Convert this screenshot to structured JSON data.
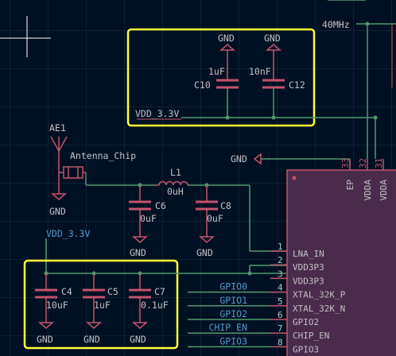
{
  "top_right": {
    "freq": "40MHz"
  },
  "box1": {
    "gnd_a": "GND",
    "gnd_b": "GND",
    "c10_value": "1uF",
    "c10_ref": "C10",
    "c12_value": "10nF",
    "c12_ref": "C12",
    "net": "VDD_3.3V"
  },
  "antenna": {
    "ref": "AE1",
    "name": "Antenna_Chip",
    "gnd": "GND"
  },
  "gnd_right": "GND",
  "l1": {
    "ref": "L1",
    "value": "0uH"
  },
  "c6": {
    "ref": "C6",
    "value": "0uF",
    "gnd": "GND"
  },
  "c8": {
    "ref": "C8",
    "value": "0uF",
    "gnd": "GND"
  },
  "vdd_left": "VDD_3.3V",
  "box2": {
    "c4_ref": "C4",
    "c4_value": "10uF",
    "gnd4": "GND",
    "c5_ref": "C5",
    "c5_value": "1uF",
    "gnd5": "GND",
    "c7_ref": "C7",
    "c7_value": "0.1uF",
    "gnd7": "GND"
  },
  "chip": {
    "top_pins": [
      {
        "num": "33",
        "name": "EP"
      },
      {
        "num": "32",
        "name": "VDDA"
      },
      {
        "num": "31",
        "name": "VDDA"
      }
    ],
    "pins": [
      {
        "num": "1",
        "name": "LNA_IN",
        "net": ""
      },
      {
        "num": "2",
        "name": "VDD3P3",
        "net": ""
      },
      {
        "num": "3",
        "name": "VDD3P3",
        "net": ""
      },
      {
        "num": "4",
        "name": "XTAL_32K_P",
        "net": "GPIO0"
      },
      {
        "num": "5",
        "name": "XTAL_32K_N",
        "net": "GPIO1"
      },
      {
        "num": "6",
        "name": "GPIO2",
        "net": "GPIO2"
      },
      {
        "num": "7",
        "name": "CHIP_EN",
        "net": "CHIP_EN"
      },
      {
        "num": "8",
        "name": "GPIO3",
        "net": "GPIO3"
      }
    ]
  }
}
